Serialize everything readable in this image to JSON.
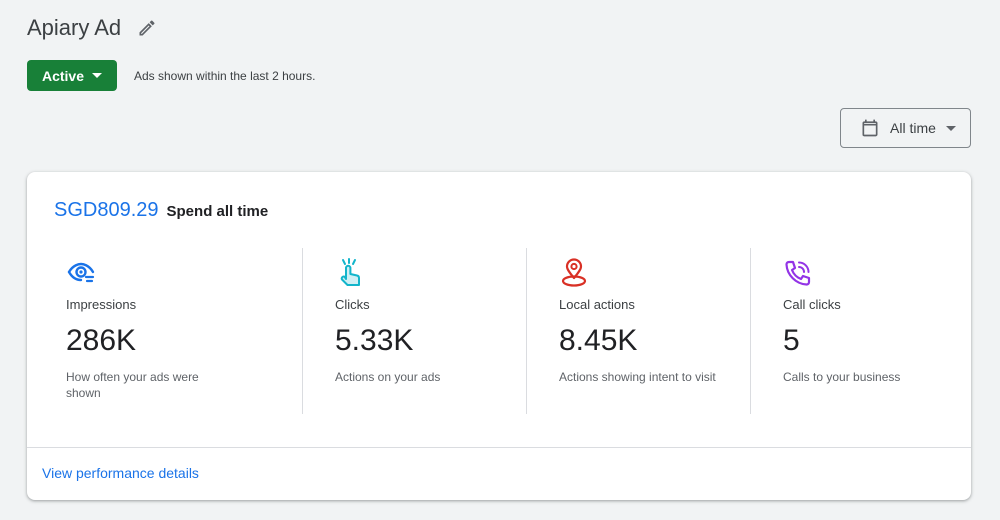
{
  "header": {
    "title": "Apiary Ad",
    "edit_icon": "pencil-icon"
  },
  "status": {
    "label": "Active",
    "note": "Ads shown within the last 2 hours.",
    "color": "#188038"
  },
  "date_range": {
    "label": "All time",
    "icon": "calendar-icon"
  },
  "summary": {
    "spend_amount": "SGD809.29",
    "spend_label": "Spend all time",
    "metrics": [
      {
        "icon": "eye-icon",
        "icon_color": "#1a73e8",
        "name": "Impressions",
        "value": "286K",
        "description": "How often your ads were shown"
      },
      {
        "icon": "tap-icon",
        "icon_color": "#12b5cb",
        "name": "Clicks",
        "value": "5.33K",
        "description": "Actions on your ads"
      },
      {
        "icon": "location-pin-icon",
        "icon_color": "#d93025",
        "name": "Local actions",
        "value": "8.45K",
        "description": "Actions showing intent to visit"
      },
      {
        "icon": "phone-call-icon",
        "icon_color": "#9334e6",
        "name": "Call clicks",
        "value": "5",
        "description": "Calls to your business"
      }
    ],
    "details_link": "View performance details",
    "link_color": "#1a73e8"
  }
}
